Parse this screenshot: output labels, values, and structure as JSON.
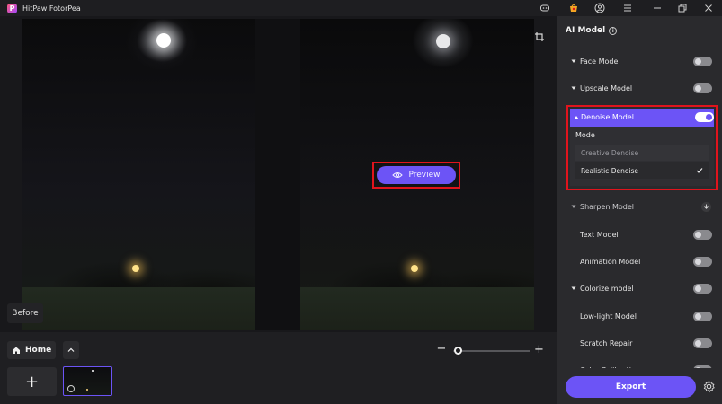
{
  "app": {
    "title": "HitPaw FotorPea",
    "logo_letter": "P"
  },
  "titlebar": {
    "icons": [
      "discord-icon",
      "shop-icon",
      "account-icon",
      "menu-icon",
      "minimize-icon",
      "restore-icon",
      "close-icon"
    ]
  },
  "canvas": {
    "before_label": "Before",
    "preview_label": "Preview"
  },
  "bottombar": {
    "home_label": "Home",
    "add_symbol": "+",
    "zoom_minus": "−",
    "zoom_plus": "+",
    "zoom_level": 0.02
  },
  "panel": {
    "title": "AI Model",
    "models": [
      {
        "label": "Face Model",
        "state": "off"
      },
      {
        "label": "Upscale Model",
        "state": "off"
      },
      {
        "label": "Denoise Model",
        "state": "on"
      },
      {
        "label": "Sharpen Model",
        "state": "download"
      },
      {
        "label": "Text Model",
        "state": "off"
      },
      {
        "label": "Animation Model",
        "state": "off"
      },
      {
        "label": "Colorize model",
        "state": "off"
      },
      {
        "label": "Low-light Model",
        "state": "off"
      },
      {
        "label": "Scratch Repair",
        "state": "off"
      },
      {
        "label": "Color Calibration",
        "state": "off"
      }
    ],
    "denoise": {
      "mode_title": "Mode",
      "options": [
        "Creative Denoise",
        "Realistic Denoise"
      ],
      "selected": "Realistic Denoise"
    },
    "export_label": "Export"
  },
  "colors": {
    "accent": "#6c54f6",
    "highlight_outline": "#e0141d",
    "panel_bg": "#2a2a2d"
  }
}
